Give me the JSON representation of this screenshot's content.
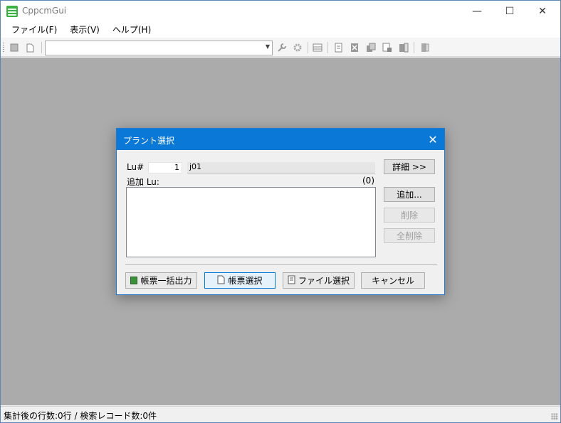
{
  "window": {
    "title": "CppcmGui",
    "minimize_glyph": "—",
    "maximize_glyph": "☐",
    "close_glyph": "✕"
  },
  "menu": [
    {
      "label": "ファイル(F)"
    },
    {
      "label": "表示(V)"
    },
    {
      "label": "ヘルプ(H)"
    }
  ],
  "toolbar": {
    "combo_value": "",
    "icons": [
      "grid-icon",
      "new-document-icon",
      "wrench-icon",
      "gear-icon",
      "table-icon",
      "document-icon",
      "excel-icon",
      "copy-icon",
      "report-icon",
      "excel-export-icon",
      "exit-icon"
    ]
  },
  "status": {
    "text": "集計後の行数:0行 / 検索レコード数:0件"
  },
  "dialog": {
    "title": "プラント選択",
    "close_glyph": "✕",
    "lu_label": "Lu#",
    "lu_value": "1",
    "lu_name": "j01",
    "add_lu_label": "追加 Lu:",
    "count_label": "(0)",
    "details_button": "詳細 >>",
    "add_button": "追加...",
    "delete_button": "削除",
    "delete_all_button": "全削除",
    "bulk_output_button": "帳票一括出力",
    "form_select_button": "帳票選択",
    "file_select_button": "ファイル選択",
    "cancel_button": "キャンセル"
  }
}
